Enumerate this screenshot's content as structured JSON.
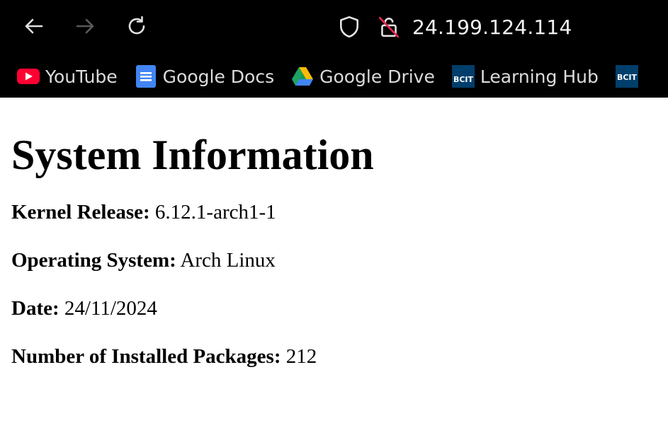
{
  "browser": {
    "url": "24.199.124.114",
    "bookmarks": [
      {
        "label": "YouTube",
        "icon": "youtube-icon"
      },
      {
        "label": "Google Docs",
        "icon": "google-docs-icon"
      },
      {
        "label": "Google Drive",
        "icon": "google-drive-icon"
      },
      {
        "label": "Learning Hub",
        "icon": "bcit-icon",
        "icon_text": "BCIT"
      },
      {
        "label": "",
        "icon": "bcit-icon",
        "icon_text": "BCIT"
      }
    ]
  },
  "page": {
    "title": "System Information",
    "fields": [
      {
        "label": "Kernel Release:",
        "value": " 6.12.1-arch1-1"
      },
      {
        "label": "Operating System:",
        "value": " Arch Linux"
      },
      {
        "label": "Date:",
        "value": " 24/11/2024"
      },
      {
        "label": "Number of Installed Packages:",
        "value": " 212"
      }
    ]
  },
  "colors": {
    "chrome_bg": "#000000",
    "youtube_red": "#ff0033",
    "docs_blue": "#4285f4",
    "bcit_blue": "#003e6b"
  }
}
